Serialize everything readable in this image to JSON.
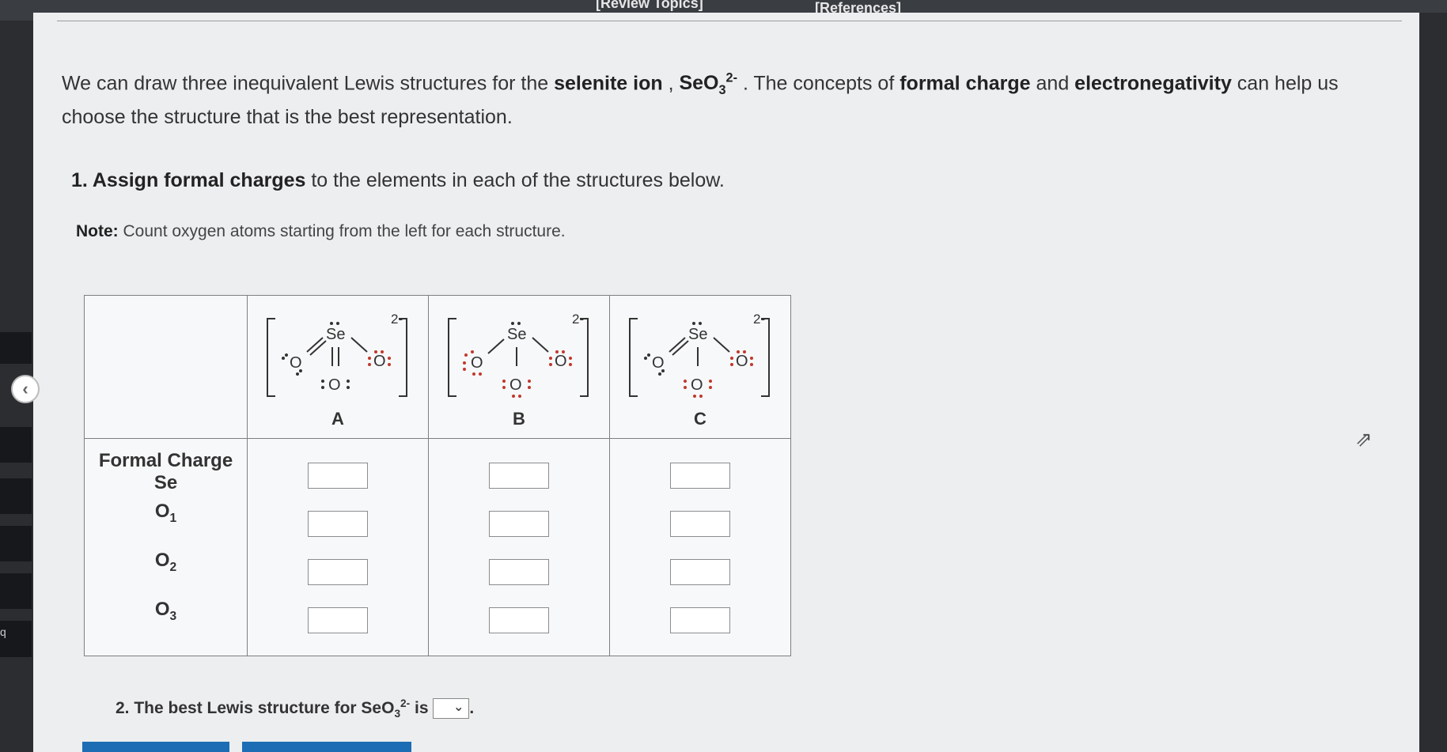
{
  "top_links": {
    "review": "[Review Topics]",
    "references": "[References]"
  },
  "intro": {
    "p1": "We can draw three inequivalent Lewis structures for the ",
    "ion_name": "selenite ion",
    "p2": " , ",
    "formula_base": "SeO",
    "formula_sub": "3",
    "formula_sup": "2-",
    "p3": " . The concepts of ",
    "bold1": "formal charge",
    "p4": " and ",
    "bold2": "electronegativity",
    "p5": " can help us choose the structure that is the best representation."
  },
  "q1": {
    "num": "1. ",
    "bold": "Assign formal charges",
    "rest": " to the elements in each of the structures below."
  },
  "note": {
    "bold": "Note:",
    "rest": " Count oxygen atoms starting from the left for each structure."
  },
  "table": {
    "structures": [
      "A",
      "B",
      "C"
    ],
    "charge": "2-",
    "se": "Se",
    "o": "O",
    "rows": [
      "Formal Charge Se",
      "O1",
      "O2",
      "O3"
    ],
    "row_labels": {
      "r0a": "Formal Charge",
      "r0b": "Se",
      "o_base": "O",
      "o1_sub": "1",
      "o2_sub": "2",
      "o3_sub": "3"
    }
  },
  "q2": {
    "text": "2. The best Lewis structure for ",
    "base": "SeO",
    "sub": "3",
    "sup": "2-",
    "is": " is",
    "end": "."
  },
  "sidebar": {
    "badge": "q"
  }
}
